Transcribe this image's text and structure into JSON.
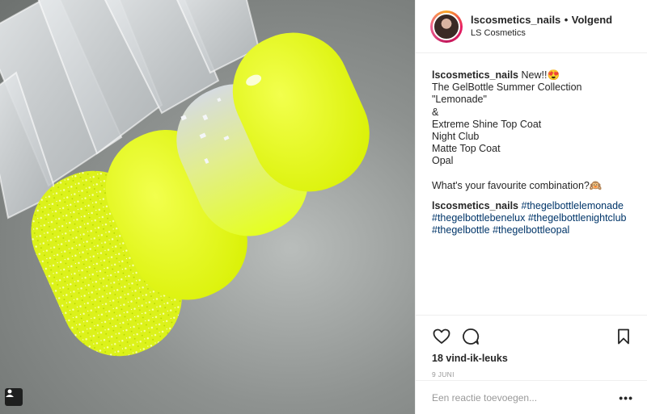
{
  "post": {
    "username": "lscosmetics_nails",
    "separator": "•",
    "follow_label": "Volgend",
    "location": "LS Cosmetics",
    "caption": {
      "author": "lscosmetics_nails",
      "first_line": "New!!😍",
      "lines": [
        "The GelBottle Summer Collection",
        "\"Lemonade\"",
        "&",
        "Extreme Shine Top Coat",
        "Night Club",
        "Matte Top Coat",
        "Opal"
      ],
      "question": "What's your favourite combination?🙉"
    },
    "comment": {
      "author": "lscosmetics_nails",
      "hashtags": [
        "#thegelbottlelemonade",
        "#thegelbottlebenelux",
        "#thegelbottlenightclub",
        "#thegelbottle",
        "#thegelbottleopal"
      ]
    },
    "likes": "18 vind-ik-leuks",
    "date": "9 JUNI",
    "comment_placeholder": "Een reactie toevoegen...",
    "more_label": "•••"
  },
  "icons": {
    "like": "heart-icon",
    "comment": "comment-bubble-icon",
    "save": "bookmark-icon",
    "tag": "user-tag-icon"
  },
  "colors": {
    "neon_yellow": "#e8ff1a",
    "hashtag_blue": "#003569",
    "avatar_ring_pink": "#e91e63",
    "avatar_ring_orange": "#f9a825"
  }
}
